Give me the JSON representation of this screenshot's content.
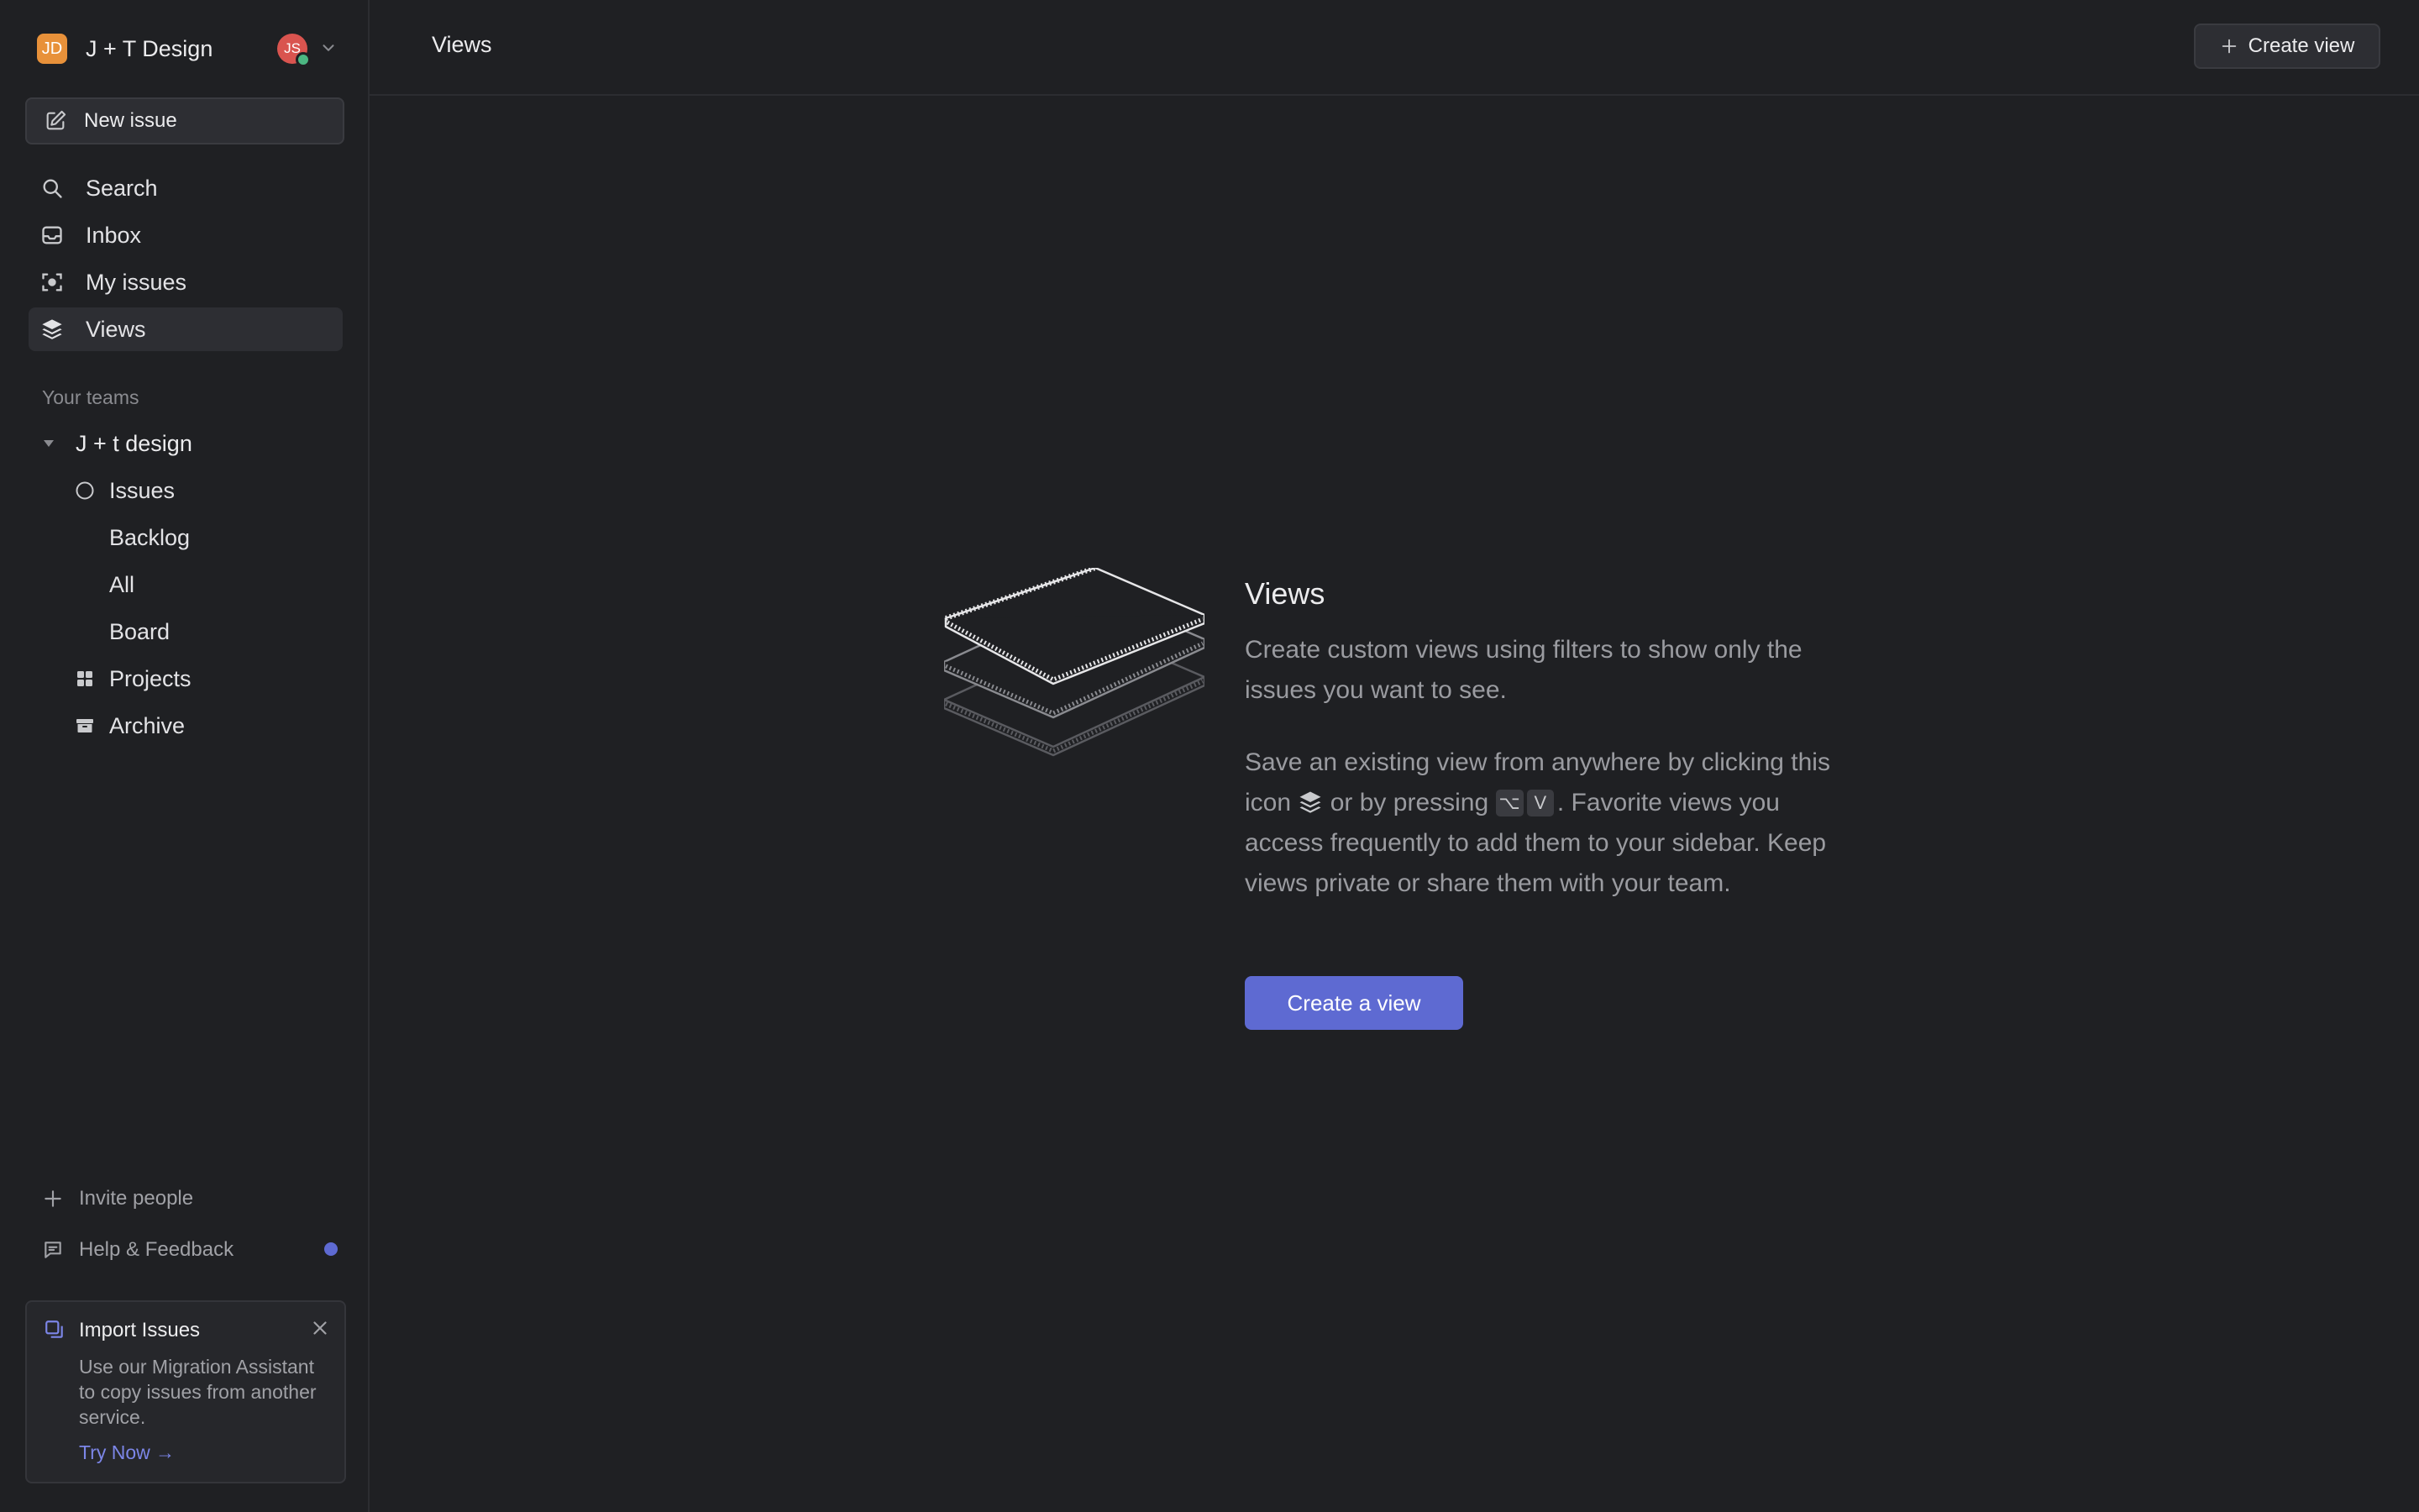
{
  "workspace": {
    "initials": "JD",
    "name": "J + T Design",
    "user_initials": "JS"
  },
  "sidebar": {
    "new_issue_label": "New issue",
    "nav": [
      {
        "label": "Search",
        "icon": "search-icon"
      },
      {
        "label": "Inbox",
        "icon": "inbox-icon"
      },
      {
        "label": "My issues",
        "icon": "my-issues-icon"
      },
      {
        "label": "Views",
        "icon": "views-layers-icon",
        "active": true
      }
    ],
    "teams_label": "Your teams",
    "team": {
      "name": "J + t design",
      "items": [
        {
          "label": "Issues",
          "icon": "circle-icon"
        },
        {
          "label": "Backlog"
        },
        {
          "label": "All"
        },
        {
          "label": "Board"
        },
        {
          "label": "Projects",
          "icon": "grid-icon"
        },
        {
          "label": "Archive",
          "icon": "archive-icon"
        }
      ]
    },
    "invite_label": "Invite people",
    "help_label": "Help & Feedback",
    "import_card": {
      "title": "Import Issues",
      "body": "Use our Migration Assistant to copy issues from another service.",
      "link": "Try Now →"
    }
  },
  "header": {
    "title": "Views",
    "create_view_label": "Create view"
  },
  "empty_state": {
    "title": "Views",
    "description": "Create custom views using filters to show only the issues you want to see.",
    "help_part1": "Save an existing view from anywhere by clicking this icon",
    "help_part2": "or by pressing",
    "shortcut_key1": "⌥",
    "shortcut_key2": "V",
    "help_part3": ". Favorite views you access frequently to add them to your sidebar. Keep views private or share them with your team.",
    "cta_label": "Create a view"
  },
  "colors": {
    "accent": "#5e6ad2",
    "background": "#1f2023",
    "workspace_logo": "#e8913a",
    "avatar": "#d9544f",
    "online": "#4cb782"
  }
}
